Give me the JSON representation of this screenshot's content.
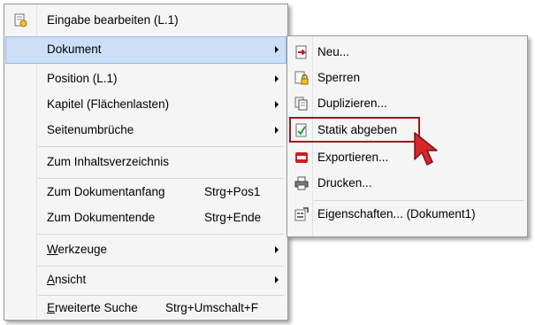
{
  "main_menu": {
    "edit_input": {
      "label": "Eingabe bearbeiten (L.1)",
      "icon": "edit-document-icon"
    },
    "dokument": {
      "label": "Dokument"
    },
    "position": {
      "label": "Position (L.1)"
    },
    "kapitel": {
      "label": "Kapitel (Flächenlasten)"
    },
    "seitenumbrueche": {
      "label": "Seitenumbrüche"
    },
    "inhaltsverzeichnis": {
      "label": "Zum Inhaltsverzeichnis"
    },
    "dokumentanfang": {
      "label": "Zum Dokumentanfang",
      "shortcut": "Strg+Pos1"
    },
    "dokumentende": {
      "label": "Zum Dokumentende",
      "shortcut": "Strg+Ende"
    },
    "werkzeuge": {
      "mnemonic": "W",
      "rest": "erkzeuge"
    },
    "ansicht": {
      "mnemonic": "A",
      "rest": "nsicht"
    },
    "erweiterte_suche": {
      "mnemonic": "E",
      "rest": "rweiterte Suche",
      "shortcut": "Strg+Umschalt+F"
    }
  },
  "submenu": {
    "neu": {
      "label": "Neu...",
      "icon": "new-document-icon"
    },
    "sperren": {
      "label": "Sperren",
      "icon": "lock-document-icon"
    },
    "duplizieren": {
      "label": "Duplizieren...",
      "icon": "duplicate-icon"
    },
    "statik": {
      "label": "Statik abgeben",
      "icon": "submit-check-icon"
    },
    "exportieren": {
      "label": "Exportieren...",
      "icon": "pdf-icon"
    },
    "drucken": {
      "label": "Drucken...",
      "icon": "printer-icon"
    },
    "eigenschaften": {
      "label": "Eigenschaften... (Dokument1)",
      "icon": "properties-icon"
    }
  },
  "colors": {
    "highlight": "#ccdff7",
    "callout_border": "#a3151b",
    "cursor": "#d9262b"
  }
}
